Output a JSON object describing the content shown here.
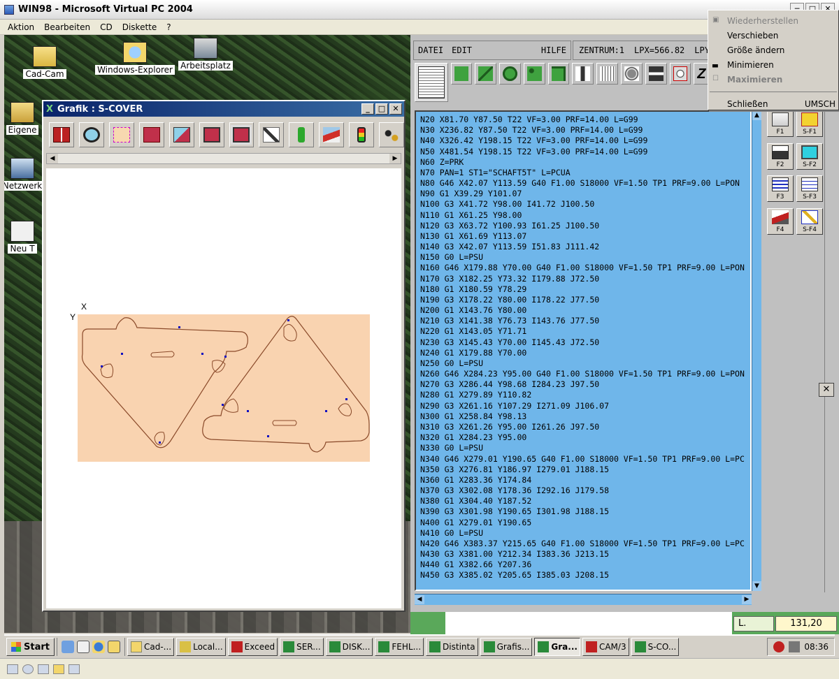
{
  "host": {
    "title": "WIN98 - Microsoft Virtual PC 2004",
    "menu": [
      "Aktion",
      "Bearbeiten",
      "CD",
      "Diskette",
      "?"
    ]
  },
  "desktop_icons": [
    {
      "label": "Cad-Cam",
      "icon": "folder-icon"
    },
    {
      "label": "Windows-Explorer",
      "icon": "explorer-icon"
    },
    {
      "label": "Arbeitsplatz",
      "icon": "computer-icon"
    },
    {
      "label": "Eigene",
      "icon": "documents-icon"
    },
    {
      "label": "Netzwerk",
      "icon": "network-icon"
    },
    {
      "label": "Neu T",
      "icon": "new-icon"
    }
  ],
  "grafik": {
    "title": "Grafik : S-COVER",
    "axis_x": "X",
    "axis_y": "Y",
    "toolbar": [
      "exit-icon",
      "zoom-icon",
      "center-icon",
      "fit-icon",
      "zoom-window-icon",
      "frame-icon",
      "full-icon",
      "pen-icon",
      "info-icon",
      "path-icon",
      "traffic-light-icon",
      "coordinates-icon"
    ]
  },
  "cam": {
    "menu": {
      "datei": "DATEI",
      "edit": "EDIT",
      "hilfe": "HILFE"
    },
    "status": {
      "zentrum": "ZENTRUM:1",
      "lpx": "LPX=566.82",
      "lpy": "LPY:"
    },
    "nc_lines": [
      "N20 X81.70 Y87.50 T22 VF=3.00 PRF=14.00 L=G99",
      "N30 X236.82 Y87.50 T22 VF=3.00 PRF=14.00 L=G99",
      "N40 X326.42 Y198.15 T22 VF=3.00 PRF=14.00 L=G99",
      "N50 X481.54 Y198.15 T22 VF=3.00 PRF=14.00 L=G99",
      "N60 Z=PRK",
      "N70 PAN=1 ST1=\"SCHAFT5T\" L=PCUA",
      "N80 G46 X42.07 Y113.59 G40 F1.00 S18000 VF=1.50 TP1 PRF=9.00 L=PON",
      "N90 G1 X39.29 Y101.07",
      "N100 G3 X41.72 Y98.00 I41.72 J100.50",
      "N110 G1 X61.25 Y98.00",
      "N120 G3 X63.72 Y100.93 I61.25 J100.50",
      "N130 G1 X61.69 Y113.07",
      "N140 G3 X42.07 Y113.59 I51.83 J111.42",
      "N150 G0 L=PSU",
      "N160 G46 X179.88 Y70.00 G40 F1.00 S18000 VF=1.50 TP1 PRF=9.00 L=PON",
      "N170 G3 X182.25 Y73.32 I179.88 J72.50",
      "N180 G1 X180.59 Y78.29",
      "N190 G3 X178.22 Y80.00 I178.22 J77.50",
      "N200 G1 X143.76 Y80.00",
      "N210 G3 X141.38 Y76.73 I143.76 J77.50",
      "N220 G1 X143.05 Y71.71",
      "N230 G3 X145.43 Y70.00 I145.43 J72.50",
      "N240 G1 X179.88 Y70.00",
      "N250 G0 L=PSU",
      "N260 G46 X284.23 Y95.00 G40 F1.00 S18000 VF=1.50 TP1 PRF=9.00 L=PON",
      "N270 G3 X286.44 Y98.68 I284.23 J97.50",
      "N280 G1 X279.89 Y110.82",
      "N290 G3 X261.16 Y107.29 I271.09 J106.07",
      "N300 G1 X258.84 Y98.13",
      "N310 G3 X261.26 Y95.00 I261.26 J97.50",
      "N320 G1 X284.23 Y95.00",
      "N330 G0 L=PSU",
      "N340 G46 X279.01 Y190.65 G40 F1.00 S18000 VF=1.50 TP1 PRF=9.00 L=PC",
      "N350 G3 X276.81 Y186.97 I279.01 J188.15",
      "N360 G1 X283.36 Y174.84",
      "N370 G3 X302.08 Y178.36 I292.16 J179.58",
      "N380 G1 X304.40 Y187.52",
      "N390 G3 X301.98 Y190.65 I301.98 J188.15",
      "N400 G1 X279.01 Y190.65",
      "N410 G0 L=PSU",
      "N420 G46 X383.37 Y215.65 G40 F1.00 S18000 VF=1.50 TP1 PRF=9.00 L=PC",
      "N430 G3 X381.00 Y212.34 I383.36 J213.15",
      "N440 G1 X382.66 Y207.36",
      "N450 G3 X385.02 Y205.65 I385.03 J208.15"
    ],
    "fkeys": [
      {
        "label": "F1",
        "icon": "open-folder-icon"
      },
      {
        "label": "S-F1",
        "icon": "help-icon"
      },
      {
        "label": "F2",
        "icon": "save-icon"
      },
      {
        "label": "S-F2",
        "icon": "screen-icon"
      },
      {
        "label": "F3",
        "icon": "list-icon"
      },
      {
        "label": "S-F3",
        "icon": "compare-icon"
      },
      {
        "label": "F4",
        "icon": "cut-icon"
      },
      {
        "label": "S-F4",
        "icon": "edit-icon"
      }
    ],
    "l_label": "L.",
    "l_value": "131,20"
  },
  "context_menu": [
    {
      "label": "Wiederherstellen",
      "disabled": true,
      "mark": "▣"
    },
    {
      "label": "Verschieben",
      "disabled": false,
      "mark": ""
    },
    {
      "label": "Größe ändern",
      "disabled": false,
      "mark": ""
    },
    {
      "label": "Minimieren",
      "disabled": false,
      "mark": "▃"
    },
    {
      "label": "Maximieren",
      "disabled": true,
      "bold": true,
      "mark": "☐"
    },
    {
      "label": "Schließen",
      "disabled": false,
      "mark": "",
      "accel": "UMSCH"
    }
  ],
  "taskbar": {
    "start": "Start",
    "tasks": [
      {
        "label": "Cad-...",
        "icon": "folder-icon"
      },
      {
        "label": "Local...",
        "icon": "local-icon"
      },
      {
        "label": "Exceed",
        "icon": "exceed-icon"
      },
      {
        "label": "SER...",
        "icon": "x-icon"
      },
      {
        "label": "DISK...",
        "icon": "x-icon"
      },
      {
        "label": "FEHL...",
        "icon": "x-icon"
      },
      {
        "label": "Distinta",
        "icon": "x-icon"
      },
      {
        "label": "Grafis...",
        "icon": "x-icon"
      },
      {
        "label": "Gra...",
        "icon": "x-icon",
        "active": true
      },
      {
        "label": "CAM/3",
        "icon": "cam-icon"
      },
      {
        "label": "S-CO...",
        "icon": "x-icon"
      }
    ],
    "clock": "08:36"
  },
  "colors": {
    "nc_background": "#6fb6ea",
    "part_fill": "#f9d3b0",
    "part_stroke": "#8a4a2a",
    "hole_marker": "#1010c0"
  }
}
